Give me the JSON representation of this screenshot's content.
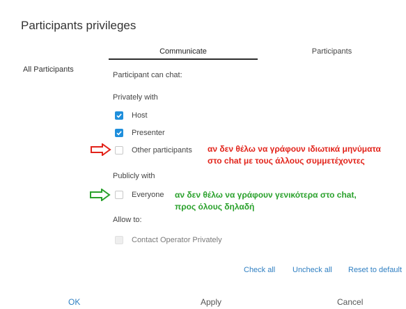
{
  "dialog": {
    "title": "Participants privileges"
  },
  "tabs": [
    {
      "label": "Communicate",
      "active": true
    },
    {
      "label": "Participants",
      "active": false
    }
  ],
  "left_panel": {
    "label": "All Participants"
  },
  "sections": {
    "can_chat": "Participant can chat:",
    "privately": "Privately with",
    "publicly": "Publicly with",
    "allow": "Allow to:"
  },
  "options": {
    "host": {
      "label": "Host",
      "checked": true
    },
    "presenter": {
      "label": "Presenter",
      "checked": true
    },
    "other_participants": {
      "label": "Other participants",
      "checked": false
    },
    "everyone": {
      "label": "Everyone",
      "checked": false
    },
    "contact_operator": {
      "label": "Contact Operator Privately",
      "checked": false,
      "disabled": true
    }
  },
  "annotations": {
    "red": {
      "line1": "αν δεν θέλω να γράφουν ιδιωτικά μηνύματα",
      "line2": "στο chat με τους άλλους συμμετέχοντες",
      "color": "#e2231a"
    },
    "green": {
      "line1": "αν δεν θέλω να γράφουν γενικότερα στο chat,",
      "line2": "προς όλους δηλαδή",
      "color": "#2aa12c"
    }
  },
  "links": {
    "check_all": "Check all",
    "uncheck_all": "Uncheck all",
    "reset": "Reset to default"
  },
  "footer": {
    "ok": "OK",
    "apply": "Apply",
    "cancel": "Cancel"
  },
  "colors": {
    "accent": "#1f8fdc",
    "link": "#2f7fc2"
  }
}
